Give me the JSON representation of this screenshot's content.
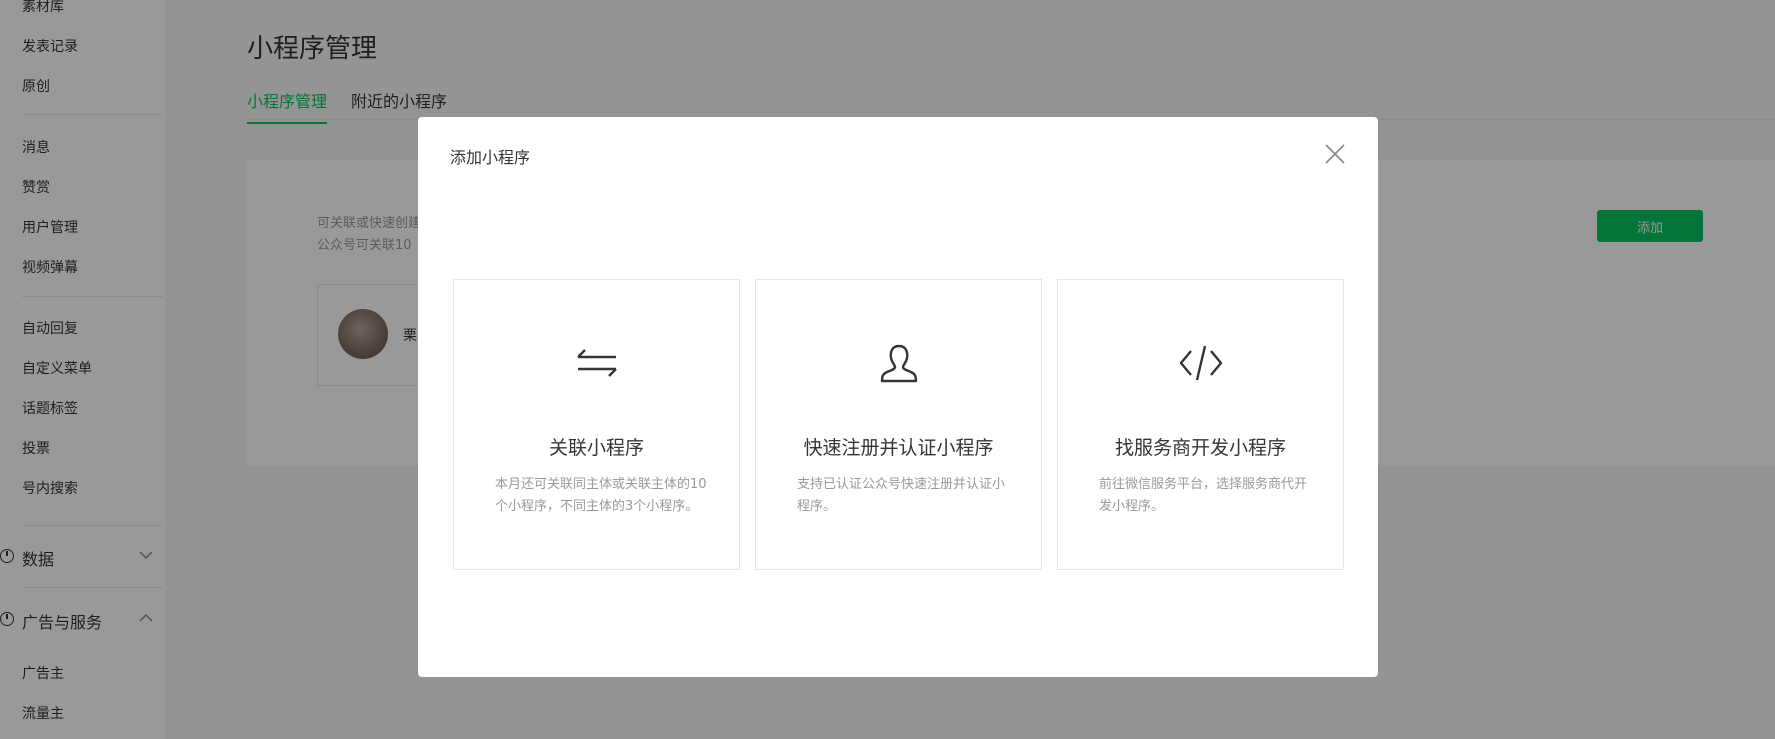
{
  "sidebar": {
    "items_top": [
      "素材库",
      "发表记录",
      "原创"
    ],
    "items_mid": [
      "消息",
      "赞赏",
      "用户管理",
      "视频弹幕"
    ],
    "items_func": [
      "自动回复",
      "自定义菜单",
      "话题标签",
      "投票",
      "号内搜索"
    ],
    "group_data": "数据",
    "group_ads": "广告与服务",
    "items_ads": [
      "广告主",
      "流量主"
    ]
  },
  "main": {
    "page_title": "小程序管理",
    "tabs": [
      {
        "label": "小程序管理",
        "active": true
      },
      {
        "label": "附近的小程序",
        "active": false
      }
    ],
    "desc_line1": "可关联或快速创建",
    "desc_line2": "公众号可关联10",
    "add_button_label": "添加",
    "bound_miniprogram_name": "栗"
  },
  "modal": {
    "title": "添加小程序",
    "options": [
      {
        "icon": "swap-arrows-icon",
        "title": "关联小程序",
        "description": "本月还可关联同主体或关联主体的10个小程序，不同主体的3个小程序。"
      },
      {
        "icon": "user-outline-icon",
        "title": "快速注册并认证小程序",
        "description": "支持已认证公众号快速注册并认证小程序。"
      },
      {
        "icon": "code-brackets-icon",
        "title": "找服务商开发小程序",
        "description": "前往微信服务平台，选择服务商代开发小程序。"
      }
    ]
  },
  "colors": {
    "accent_green": "#07c160",
    "overlay": "rgba(0,0,0,0.4)",
    "text_primary": "#353535",
    "text_secondary": "#9a9a9a",
    "border": "#e4e8eb"
  }
}
